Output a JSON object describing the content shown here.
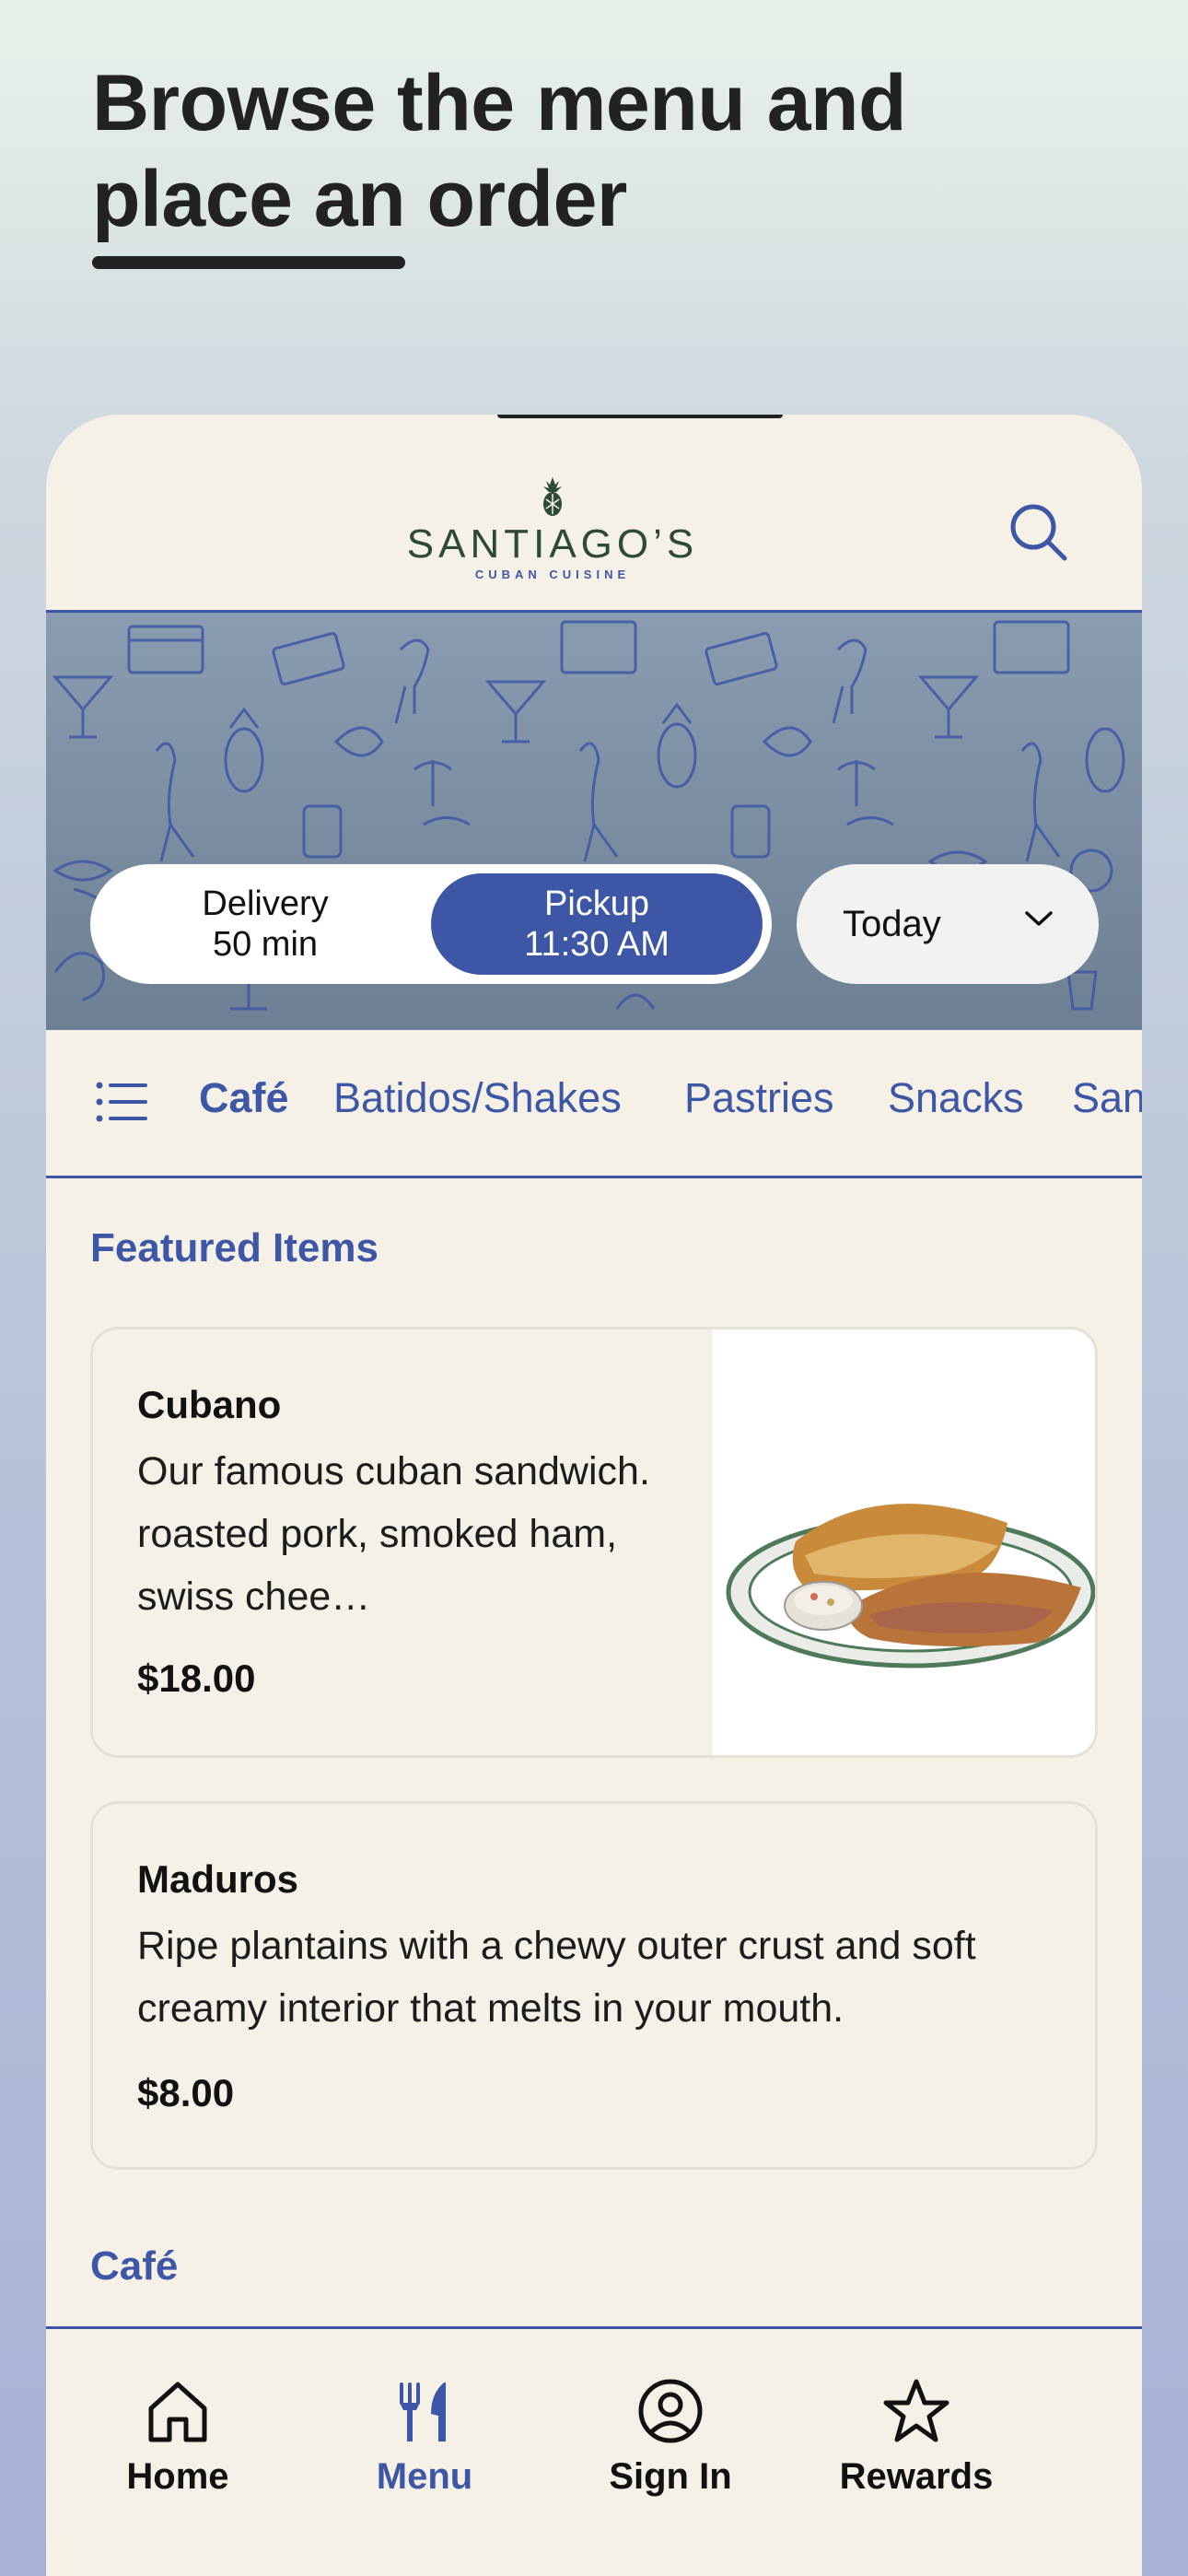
{
  "headline": "Browse the menu and place an order",
  "header": {
    "brand_name": "SANTIAGO’S",
    "brand_tagline": "CUBAN CUISINE",
    "search_icon": "search-icon"
  },
  "order_mode": {
    "delivery_label": "Delivery",
    "delivery_time": "50 min",
    "pickup_label": "Pickup",
    "pickup_time": "11:30 AM",
    "selected": "pickup",
    "date_value": "Today"
  },
  "categories": {
    "menu_icon": "list-icon",
    "items": [
      "Café",
      "Batidos/Shakes",
      "Pastries",
      "Snacks",
      "Sandwiches"
    ],
    "active": "Café"
  },
  "featured": {
    "title": "Featured Items",
    "items": [
      {
        "name": "Cubano",
        "description": "Our famous cuban sandwich. roasted pork, smoked ham, swiss chee…",
        "price": "$18.00"
      },
      {
        "name": "Maduros",
        "description": "Ripe plantains with a chewy outer crust and soft creamy interior that melts in your mouth.",
        "price": "$8.00"
      }
    ]
  },
  "next_section_title": "Café",
  "bottom_nav": {
    "items": [
      {
        "label": "Home",
        "icon": "home-icon"
      },
      {
        "label": "Menu",
        "icon": "fork-knife-icon"
      },
      {
        "label": "Sign In",
        "icon": "user-circle-icon"
      },
      {
        "label": "Rewards",
        "icon": "star-icon"
      }
    ],
    "active": "Menu"
  },
  "colors": {
    "accent": "#3d57a6",
    "brand_green": "#2c4a36",
    "surface": "#f5f1e7"
  }
}
